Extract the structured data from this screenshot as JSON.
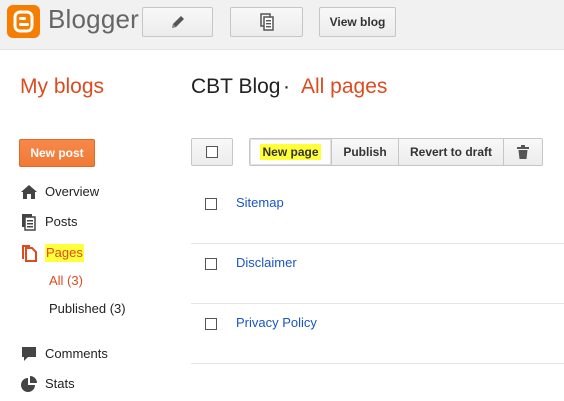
{
  "header": {
    "brand": "Blogger",
    "logo_icon": "blogger-logo-icon",
    "edit_icon": "pencil-icon",
    "pages_icon": "document-icon",
    "view_blog_label": "View blog",
    "accent_color": "#f57d00"
  },
  "headline": {
    "my_blogs": "My blogs",
    "blog_name": "CBT Blog",
    "separator": "·",
    "section": "All pages"
  },
  "sidebar": {
    "new_post_label": "New post",
    "items": [
      {
        "label": "Overview",
        "icon": "home-icon"
      },
      {
        "label": "Posts",
        "icon": "posts-icon"
      },
      {
        "label": "Pages",
        "icon": "pages-icon",
        "active": true
      },
      {
        "label": "Comments",
        "icon": "comment-icon"
      },
      {
        "label": "Stats",
        "icon": "pie-chart-icon"
      }
    ],
    "pages_sub": [
      {
        "label": "All (3)",
        "active": true
      },
      {
        "label": "Published (3)"
      }
    ]
  },
  "toolbar": {
    "new_page_label": "New page",
    "publish_label": "Publish",
    "revert_label": "Revert to draft",
    "trash_icon": "trash-icon"
  },
  "pages": [
    {
      "title": "Sitemap"
    },
    {
      "title": "Disclaimer"
    },
    {
      "title": "Privacy Policy"
    }
  ]
}
